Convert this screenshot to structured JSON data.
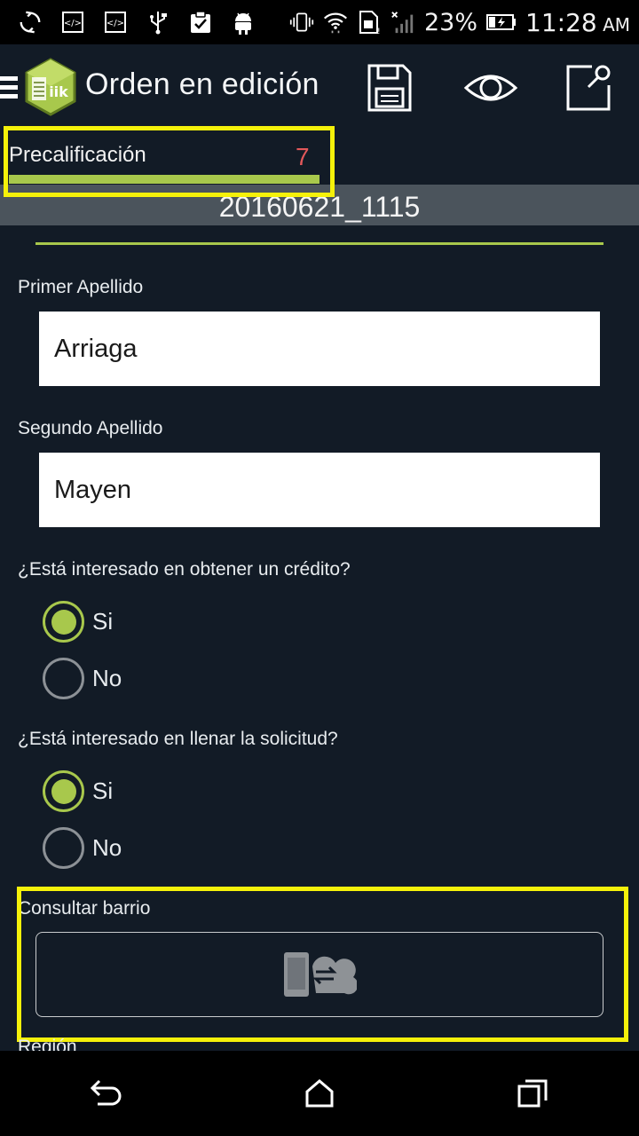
{
  "status_bar": {
    "battery_percent": "23%",
    "time": "11:28",
    "ampm": "AM",
    "icons": [
      "sync-icon",
      "code-icon",
      "code-icon",
      "usb-icon",
      "clipboard-check-icon",
      "android-icon",
      "vibrate-icon",
      "wifi-icon",
      "sim-icon",
      "signal-icon",
      "battery-charging-icon"
    ]
  },
  "appbar": {
    "title": "Orden en edición",
    "actions": [
      "save-icon",
      "eye-icon",
      "edit-icon"
    ]
  },
  "tab": {
    "label": "Precalificación",
    "count": "7"
  },
  "order_id": "20160621_1115",
  "form": {
    "primer_apellido": {
      "label": "Primer Apellido",
      "value": "Arriaga"
    },
    "segundo_apellido": {
      "label": "Segundo Apellido",
      "value": "Mayen"
    },
    "credito": {
      "question": "¿Está interesado en obtener un crédito?",
      "options": [
        "Si",
        "No"
      ],
      "selected": "Si"
    },
    "solicitud": {
      "question": "¿Está interesado en llenar la solicitud?",
      "options": [
        "Si",
        "No"
      ],
      "selected": "Si"
    },
    "consultar_barrio": {
      "label": "Consultar barrio",
      "icon": "phone-cloud-sync-icon"
    },
    "next_label": "Región"
  },
  "colors": {
    "accent": "#a8c84c",
    "background": "#121b26",
    "highlight": "#f5f10a",
    "count": "#e2585a"
  }
}
